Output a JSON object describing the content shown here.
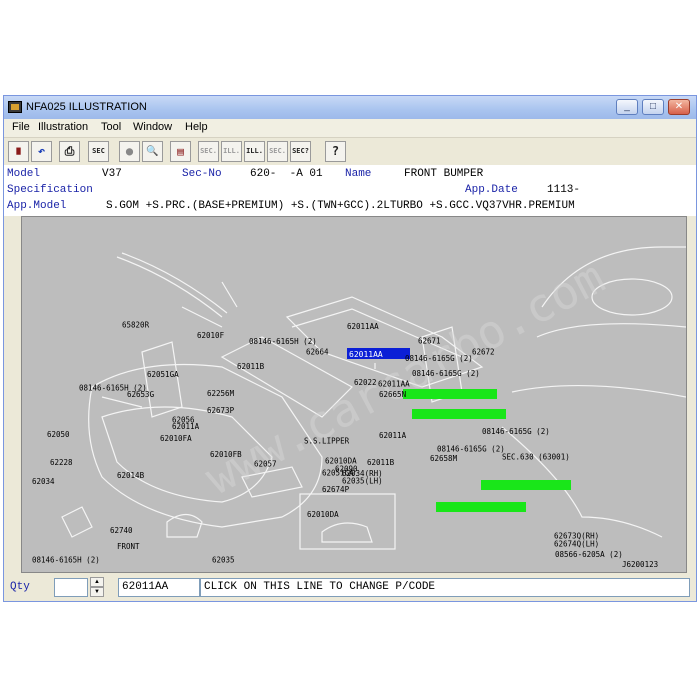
{
  "window": {
    "title": "NFA025 ILLUSTRATION",
    "controls": {
      "minimize": "_",
      "maximize": "□",
      "close": "✕"
    }
  },
  "menu": [
    "File",
    "Illustration",
    "Tool",
    "Window",
    "Help"
  ],
  "toolbar": {
    "buttons": [
      {
        "name": "tool-book-icon",
        "glyph": "▇"
      },
      {
        "name": "tool-undo-icon",
        "glyph": "↶"
      },
      {
        "name": "tool-print-icon",
        "glyph": "⎙"
      },
      {
        "name": "tool-sec-icon",
        "glyph": "SEC"
      },
      {
        "name": "tool-circle-icon",
        "glyph": "●"
      },
      {
        "name": "tool-magnify-icon",
        "glyph": "🔍"
      },
      {
        "name": "tool-doc-icon",
        "glyph": "▤"
      },
      {
        "name": "tool-prev-sec-icon",
        "glyph": "SEC.",
        "disabled": true
      },
      {
        "name": "tool-prev-ill-icon",
        "glyph": "ILL.",
        "disabled": true
      },
      {
        "name": "tool-next-ill-icon",
        "glyph": "ILL."
      },
      {
        "name": "tool-next-sec-icon",
        "glyph": "SEC.",
        "disabled": true
      },
      {
        "name": "tool-sec-search-icon",
        "glyph": "SEC?"
      },
      {
        "name": "tool-help-icon",
        "glyph": "?"
      }
    ]
  },
  "info": {
    "model_label": "Model",
    "model_value": "V37",
    "secno_label": "Sec-No",
    "secno_value": "620-  -A 01",
    "name_label": "Name",
    "name_value": "FRONT BUMPER",
    "spec_label": "Specification",
    "appdate_label": "App.Date",
    "appdate_value": "1113-",
    "appmodel_label": "App.Model",
    "appmodel_value": "S.GOM +S.PRC.(BASE+PREMIUM) +S.(TWN+GCC).2LTURBO +S.GCC.VQ37VHR.PREMIUM"
  },
  "illustration": {
    "labels": [
      "62011AA",
      "62671",
      "62672",
      "62664",
      "08146-6165G (2)",
      "08146-6165G (2)",
      "62022",
      "62011AA",
      "62665N",
      "62011A",
      "08146-6165G (2)",
      "08146-6165G (2)",
      "62658M",
      "SEC.630 (63001)",
      "65820R",
      "62010F",
      "08146-6165H (2)",
      "62011B",
      "62051GA",
      "08146-6165H (2)",
      "62653G",
      "62256M",
      "62673P",
      "62056",
      "62011A",
      "62050",
      "62010FA",
      "62010FB",
      "62057",
      "62090",
      "62011B",
      "62051GA",
      "62674P",
      "62228",
      "62014B",
      "62034",
      "62010DA",
      "62740",
      "FRONT",
      "08146-6165H (2)",
      "S.S.LIPPER",
      "62010DA",
      "62034(RH)",
      "62035(LH)",
      "62035",
      "62673Q(RH)",
      "62674Q(LH)",
      "08566-6205A (2)",
      "J6200123"
    ],
    "highlight_blue": "62011AA",
    "highlight_green": [
      "08146-6165G",
      "08146-6165G",
      "08146-6165G",
      "08146-6165G"
    ],
    "watermark": "www.carcarbo.com",
    "colors": {
      "blue": "#0b1fd6",
      "green": "#19e619",
      "background": "#bdbdbd"
    }
  },
  "bottom": {
    "qty_label": "Qty",
    "qty_value": "",
    "partcode": "62011AA",
    "message": "CLICK ON THIS LINE TO CHANGE P/CODE"
  }
}
